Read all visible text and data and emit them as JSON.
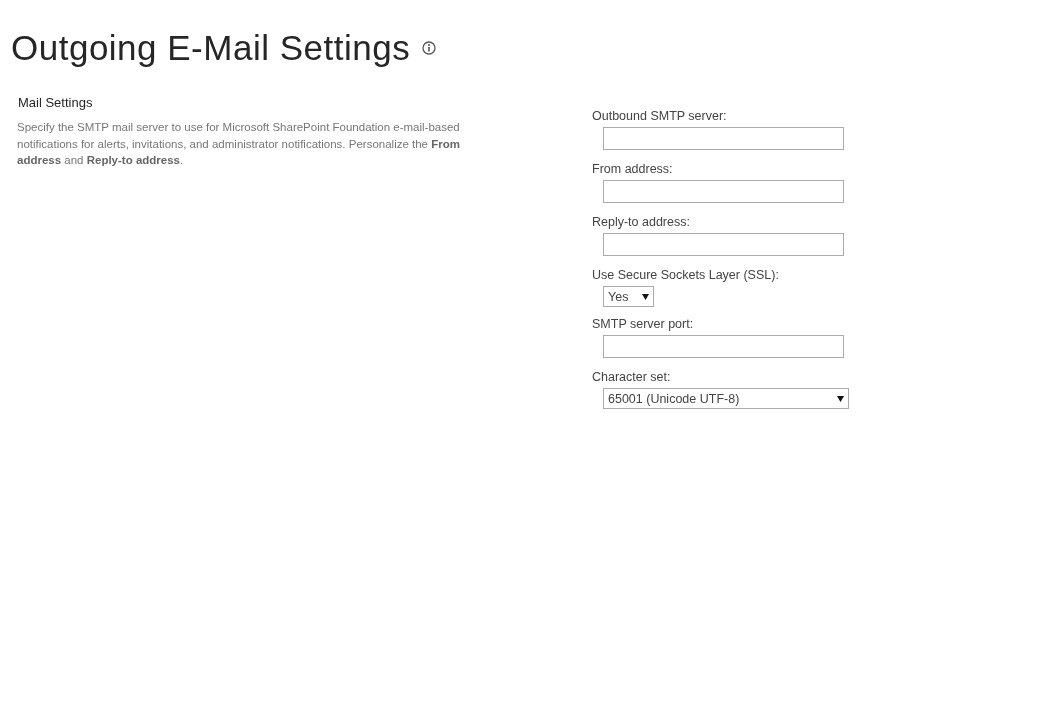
{
  "page": {
    "title": "Outgoing E-Mail Settings"
  },
  "section": {
    "heading": "Mail Settings",
    "description": "Specify the SMTP mail server to use for Microsoft SharePoint Foundation e-mail-based notifications for alerts, invitations, and administrator notifications.  Personalize the **From address** and **Reply-to address**."
  },
  "fields": [
    {
      "kind": "text",
      "label": "Outbound SMTP server:"
    },
    {
      "kind": "text",
      "label": "From address:"
    },
    {
      "kind": "text",
      "label": "Reply-to address:"
    },
    {
      "kind": "select",
      "label": "Use Secure Sockets Layer (SSL):",
      "value": "Yes"
    },
    {
      "kind": "text",
      "label": "SMTP server port:"
    },
    {
      "kind": "select",
      "label": "Character set:",
      "value": "65001 (Unicode UTF-8)"
    }
  ]
}
